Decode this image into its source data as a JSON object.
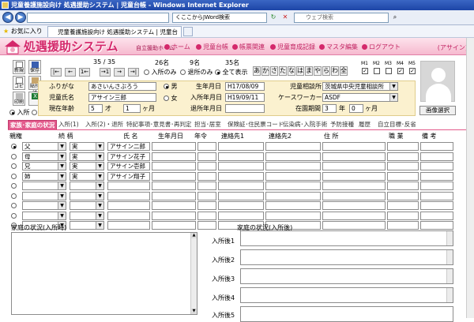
{
  "window": {
    "title": "児童養護施設向け 処遇援助システム | 児童台帳 - Windows Internet Explorer"
  },
  "browser": {
    "address_right": "くここからJWord検索",
    "search_placeholder": "ウェブ検索",
    "favorites": "お気に入り",
    "tab_title": "児童養護施設向け 処遇援助システム | 児童台帳"
  },
  "app": {
    "title": "処遇援助システム",
    "subtitle": "自立援助ホーム",
    "menu": [
      "ホーム",
      "児童台帳",
      "帳票関連",
      "児童育成記録",
      "マスタ編集",
      "ログアウト"
    ],
    "user_link": "(アサイン)"
  },
  "side_buttons": {
    "new": "新規",
    "save": "保存",
    "copy": "コピー",
    "paste": "貼付け",
    "print": "印刷",
    "excel": "Excel"
  },
  "nav": {
    "record_position": "35 / 35"
  },
  "filters": [
    {
      "count": "26名",
      "label": "入所のみ",
      "selected": false
    },
    {
      "count": "9名",
      "label": "退所のみ",
      "selected": false
    },
    {
      "count": "35名",
      "label": "全て表示",
      "selected": true
    }
  ],
  "status_radios": [
    {
      "label": "入所",
      "selected": true
    },
    {
      "label": "退所",
      "selected": false
    }
  ],
  "kana_index": [
    "あ",
    "か",
    "さ",
    "た",
    "な",
    "は",
    "ま",
    "や",
    "ら",
    "わ",
    "全"
  ],
  "m_flags": [
    {
      "label": "M1",
      "checked": true
    },
    {
      "label": "M2",
      "checked": false
    },
    {
      "label": "M3",
      "checked": false
    },
    {
      "label": "M4",
      "checked": true
    },
    {
      "label": "M5",
      "checked": true
    }
  ],
  "child": {
    "furigana_label": "ふりがな",
    "furigana": "あさいんさぶろう",
    "name_label": "児童氏名",
    "name": "アサイン三郎",
    "age_label": "現在年齢",
    "age_years": "5",
    "age_years_unit": "才",
    "age_months": "1",
    "age_months_unit": "ヶ月",
    "sex": [
      {
        "label": "男",
        "selected": true
      },
      {
        "label": "女",
        "selected": false
      }
    ],
    "birth_label": "生年月日",
    "birth": "H17/08/09",
    "admit_label": "入所年月日",
    "admit": "H19/09/11",
    "leave_label": "退所年月日",
    "leave": "",
    "center_label": "児童相談所",
    "center": "茨城県中央児童相談所",
    "worker_label": "ケースワーカー",
    "worker": "ASDF",
    "period_label": "在園期間",
    "period_years": "3",
    "period_years_unit": "年",
    "period_months": "0",
    "period_months_unit": "ヶ月"
  },
  "image_select": "画像選択",
  "tabs": [
    "家族･家庭の状況",
    "入所(1)",
    "入所(2)・退所",
    "特記事項･意見書･再判定",
    "担当･居室",
    "保険証･住民票コード",
    "伝染病･入院手術",
    "予防接種",
    "履歴",
    "自立目標･反省"
  ],
  "family_table": {
    "headers": [
      "親権",
      "続 柄",
      "",
      "氏 名",
      "生年月日",
      "年令",
      "連絡先1",
      "連絡先2",
      "住 所",
      "職 業",
      "備 考"
    ],
    "rows": [
      {
        "selected": true,
        "relation": "父",
        "type": "実",
        "name": "アサイン二郎"
      },
      {
        "selected": false,
        "relation": "母",
        "type": "実",
        "name": "アサイン花子"
      },
      {
        "selected": false,
        "relation": "兄",
        "type": "実",
        "name": "アサイン壱郎"
      },
      {
        "selected": false,
        "relation": "姉",
        "type": "実",
        "name": "アサイン翔子"
      },
      {
        "selected": false,
        "relation": "",
        "type": "",
        "name": ""
      },
      {
        "selected": false,
        "relation": "",
        "type": "",
        "name": ""
      },
      {
        "selected": false,
        "relation": "",
        "type": "",
        "name": ""
      },
      {
        "selected": false,
        "relation": "",
        "type": "",
        "name": ""
      },
      {
        "selected": false,
        "relation": "",
        "type": "",
        "name": ""
      }
    ]
  },
  "family_status": {
    "left_label": "家庭の状況(入所時)",
    "right_label": "家庭の状況(入所後)",
    "after": [
      "入所後1",
      "入所後2",
      "入所後3",
      "入所後4",
      "入所後5"
    ]
  }
}
